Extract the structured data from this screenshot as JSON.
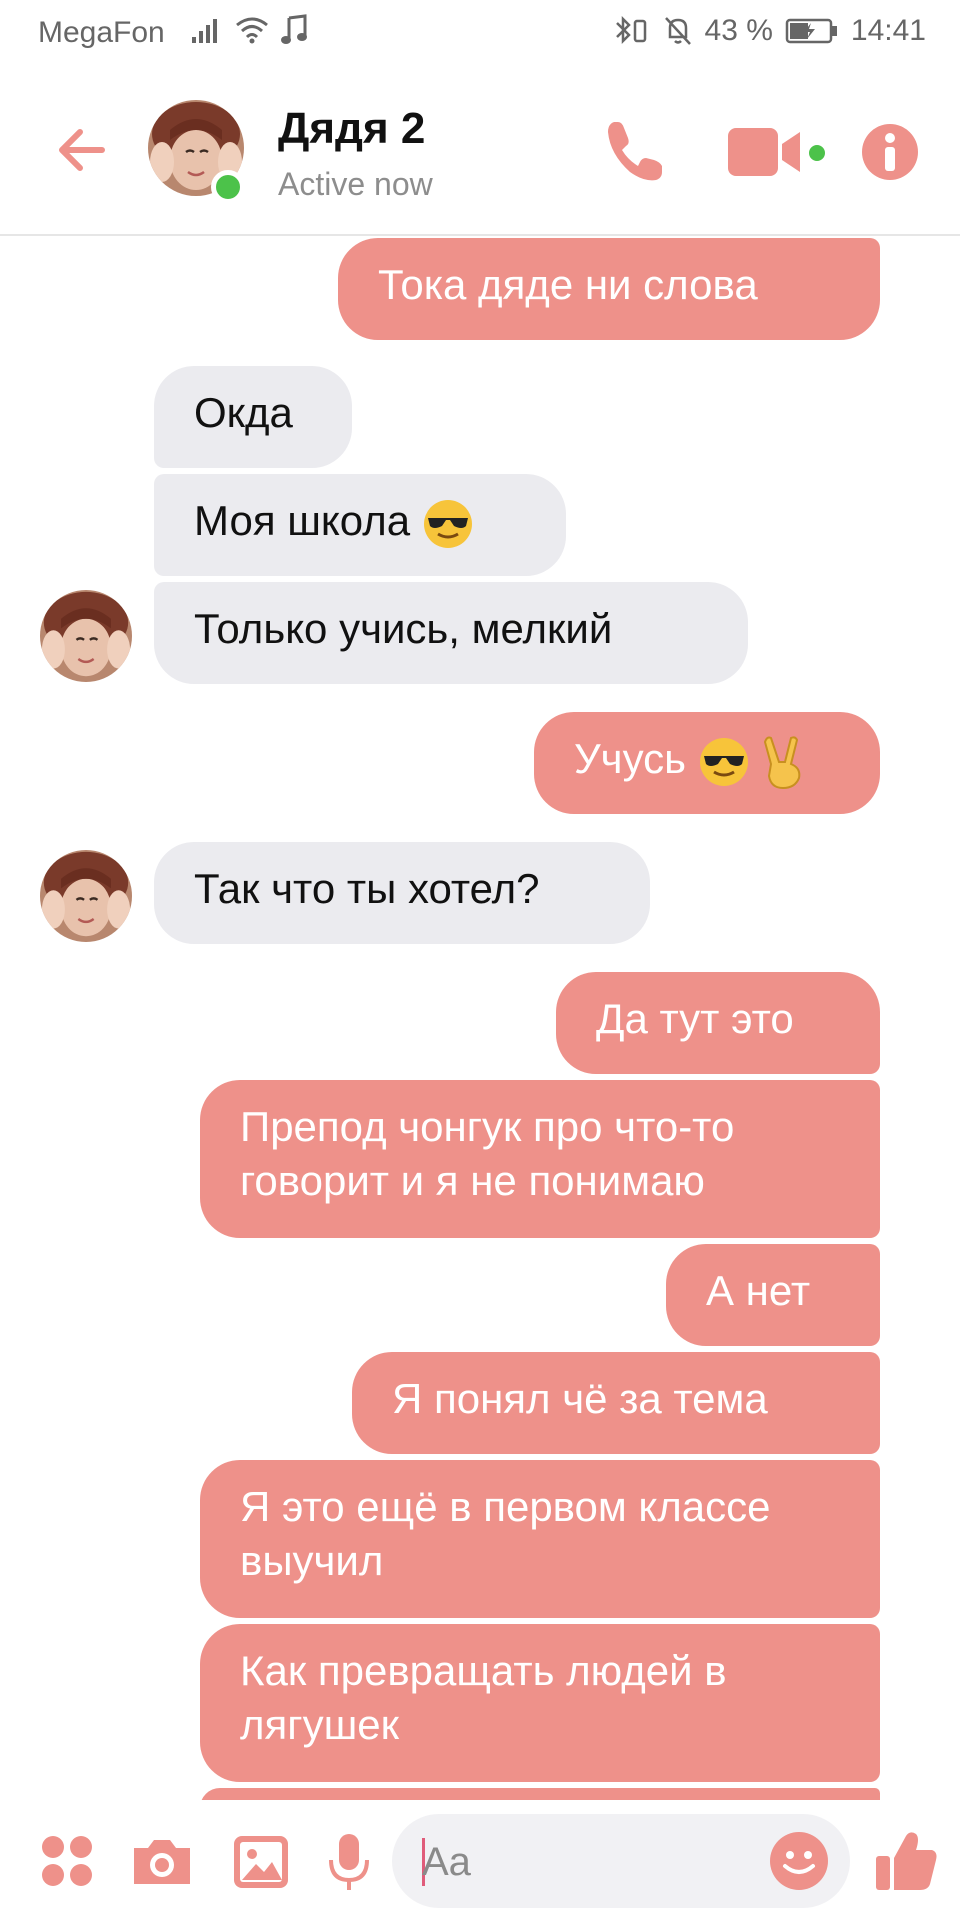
{
  "status_bar": {
    "carrier": "MegaFon",
    "battery_percent": "43 %",
    "time": "14:41"
  },
  "header": {
    "contact_name": "Дядя 2",
    "contact_status": "Active now"
  },
  "messages": [
    {
      "side": "out",
      "text": "Тока дяде ни слова"
    },
    {
      "side": "in",
      "text": "Окда"
    },
    {
      "side": "in",
      "text": "Моя школа"
    },
    {
      "side": "in",
      "text": "Только учись, мелкий"
    },
    {
      "side": "out",
      "text": "Учусь"
    },
    {
      "side": "in",
      "text": "Так что ты хотел?"
    },
    {
      "side": "out",
      "text": "Да тут это"
    },
    {
      "side": "out",
      "text": "Препод чонгук про что-то говорит и я не понимаю"
    },
    {
      "side": "out",
      "text": "А нет"
    },
    {
      "side": "out",
      "text": "Я понял чё за тема"
    },
    {
      "side": "out",
      "text": "Я это ещё в первом классе выучил"
    },
    {
      "side": "out",
      "text": "Как превращать людей в лягушек"
    }
  ],
  "composer": {
    "placeholder": "Aa"
  },
  "theme": {
    "accent": "#ee918a",
    "incoming_bubble": "#ebebef",
    "online": "#4cc24a"
  },
  "icons": [
    "back-arrow-icon",
    "phone-icon",
    "video-camera-icon",
    "info-icon",
    "more-apps-icon",
    "camera-icon",
    "gallery-icon",
    "microphone-icon",
    "emoji-icon",
    "thumbs-up-icon"
  ]
}
